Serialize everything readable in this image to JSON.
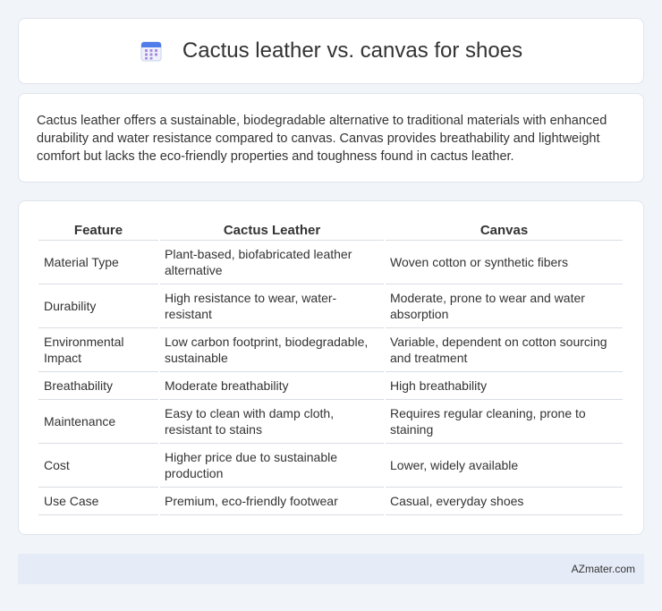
{
  "title": "Cactus leather vs. canvas for shoes",
  "intro": "Cactus leather offers a sustainable, biodegradable alternative to traditional materials with enhanced durability and water resistance compared to canvas. Canvas provides breathability and lightweight comfort but lacks the eco-friendly properties and toughness found in cactus leather.",
  "table": {
    "headers": [
      "Feature",
      "Cactus Leather",
      "Canvas"
    ],
    "rows": [
      [
        "Material Type",
        "Plant-based, biofabricated leather alternative",
        "Woven cotton or synthetic fibers"
      ],
      [
        "Durability",
        "High resistance to wear, water-resistant",
        "Moderate, prone to wear and water absorption"
      ],
      [
        "Environmental Impact",
        "Low carbon footprint, biodegradable, sustainable",
        "Variable, dependent on cotton sourcing and treatment"
      ],
      [
        "Breathability",
        "Moderate breathability",
        "High breathability"
      ],
      [
        "Maintenance",
        "Easy to clean with damp cloth, resistant to stains",
        "Requires regular cleaning, prone to staining"
      ],
      [
        "Cost",
        "Higher price due to sustainable production",
        "Lower, widely available"
      ],
      [
        "Use Case",
        "Premium, eco-friendly footwear",
        "Casual, everyday shoes"
      ]
    ]
  },
  "footer": "AZmater.com",
  "colors": {
    "icon_blue": "#4f7ce8",
    "icon_grid": "#a78bdf",
    "footer_bg": "#e6ecf7"
  }
}
